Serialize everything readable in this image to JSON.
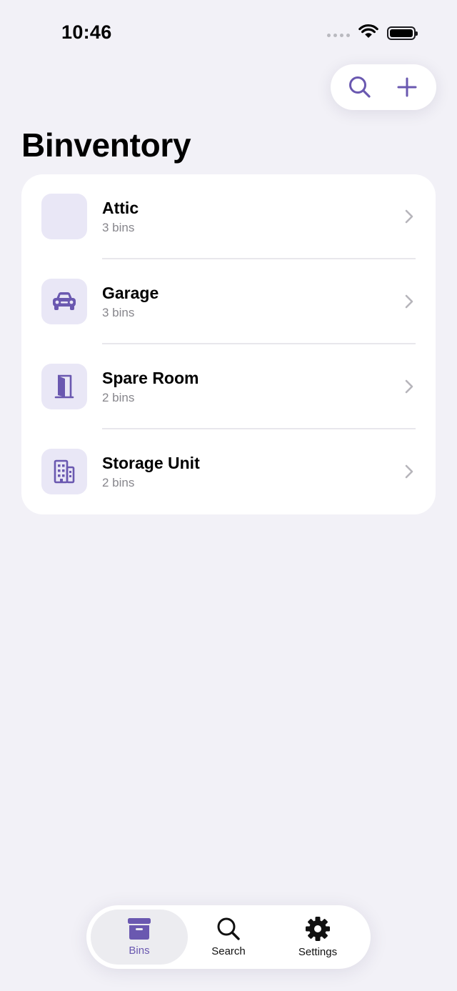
{
  "status_bar": {
    "time": "10:46"
  },
  "app": {
    "title": "Binventory",
    "accent_color": "#6a58b0"
  },
  "toolbar": {
    "search_icon": "magnifying-glass-icon",
    "add_icon": "plus-icon"
  },
  "locations": [
    {
      "name": "Attic",
      "subtitle": "3 bins",
      "icon": "none"
    },
    {
      "name": "Garage",
      "subtitle": "3 bins",
      "icon": "car-icon"
    },
    {
      "name": "Spare Room",
      "subtitle": "2 bins",
      "icon": "door-icon"
    },
    {
      "name": "Storage Unit",
      "subtitle": "2 bins",
      "icon": "building-icon"
    }
  ],
  "tab_bar": {
    "tabs": [
      {
        "label": "Bins",
        "icon": "archive-box-icon",
        "selected": true
      },
      {
        "label": "Search",
        "icon": "magnifying-glass-icon",
        "selected": false
      },
      {
        "label": "Settings",
        "icon": "gear-icon",
        "selected": false
      }
    ]
  }
}
